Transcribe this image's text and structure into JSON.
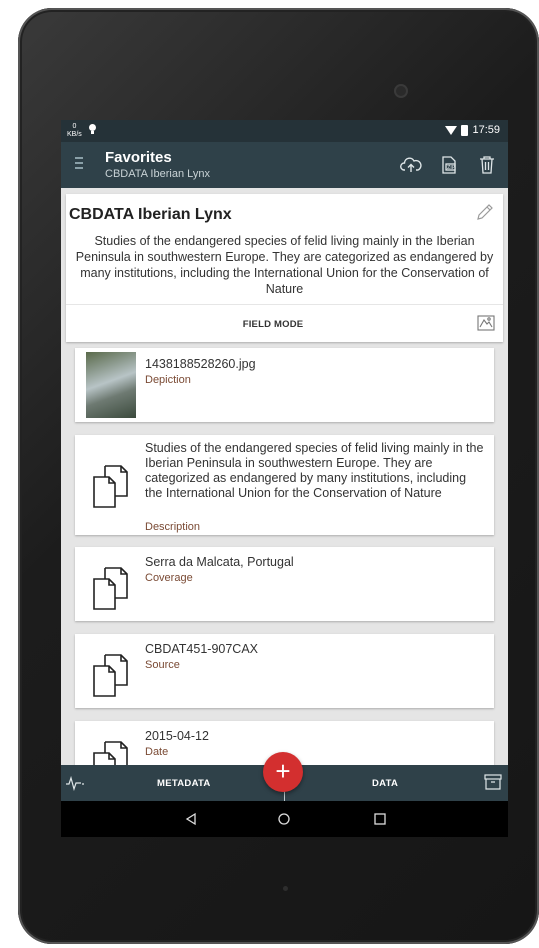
{
  "status_bar": {
    "speed_value": "0",
    "speed_unit": "KB/s",
    "time": "17:59"
  },
  "app_bar": {
    "title": "Favorites",
    "subtitle": "CBDATA Iberian Lynx",
    "actions": [
      "cloud-upload-icon",
      "zip-file-icon",
      "trash-icon"
    ]
  },
  "header": {
    "title": "CBDATA Iberian Lynx",
    "description": "Studies of the endangered species of felid living mainly in the Iberian Peninsula in southwestern Europe. They are categorized as endangered by many institutions, including the International Union for the Conservation of Nature",
    "field_mode_label": "FIELD MODE"
  },
  "records": [
    {
      "value": "1438188528260.jpg",
      "label": "Depiction",
      "icon": "image-thumbnail"
    },
    {
      "value": "Studies of the endangered species of felid living mainly in the Iberian Peninsula in southwestern Europe. They are categorized as endangered by many institutions, including the International Union for the Conservation of Nature",
      "label": "Description",
      "icon": "document-icon"
    },
    {
      "value": "Serra da Malcata, Portugal",
      "label": "Coverage",
      "icon": "document-icon"
    },
    {
      "value": "CBDAT451-907CAX",
      "label": "Source",
      "icon": "document-icon"
    },
    {
      "value": "2015-04-12",
      "label": "Date",
      "icon": "document-icon"
    }
  ],
  "bottom_bar": {
    "metadata_label": "METADATA",
    "data_label": "DATA",
    "fab_symbol": "+"
  },
  "colors": {
    "app_bar": "#2f4149",
    "status_bar": "#253238",
    "fab": "#d32f2f",
    "label_text": "#7a4a34"
  }
}
